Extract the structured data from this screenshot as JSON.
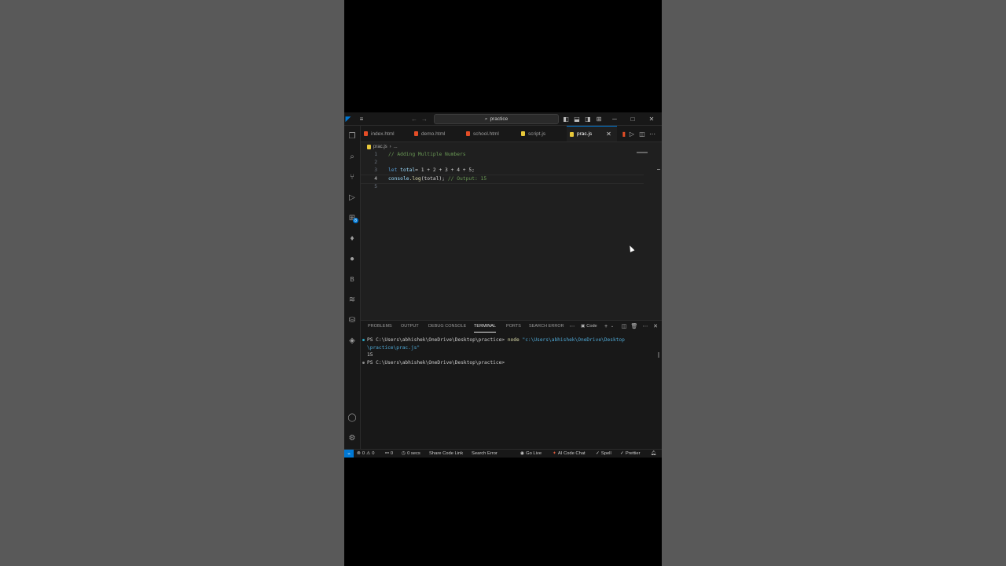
{
  "colors": {
    "accent": "#0078d4",
    "background": "#1f1f1f",
    "html_icon": "#e44d26",
    "js_icon": "#e8c83a"
  },
  "titlebar": {
    "app_icon": "vscode-icon",
    "menu_icon": "hamburger-icon",
    "search_text": "practice"
  },
  "tabs": [
    {
      "label": "index.html",
      "type": "html",
      "active": false
    },
    {
      "label": "demo.html",
      "type": "html",
      "active": false
    },
    {
      "label": "school.html",
      "type": "html",
      "active": false
    },
    {
      "label": "script.js",
      "type": "js",
      "active": false
    },
    {
      "label": "prac.js",
      "type": "js",
      "active": true
    }
  ],
  "breadcrumb": {
    "file": "prac.js",
    "rest": "..."
  },
  "activity_bar": {
    "extensions_badge": "8",
    "bottom_label": "B"
  },
  "editor": {
    "lines": [
      {
        "num": "1",
        "text": "// Adding Multiple Numbers"
      },
      {
        "num": "2",
        "text": ""
      },
      {
        "num": "3",
        "kw": "let",
        "var": "total",
        "expr": " = 1 + 2 + 3 + 4 + 5;"
      },
      {
        "num": "4",
        "obj": "console",
        "fn": ".log",
        "args": "(total);",
        "comment": "// Output: 15"
      },
      {
        "num": "5",
        "text": ""
      }
    ]
  },
  "panel": {
    "tabs": [
      "PROBLEMS",
      "OUTPUT",
      "DEBUG CONSOLE",
      "TERMINAL",
      "PORTS",
      "SEARCH ERROR"
    ],
    "active_tab": "TERMINAL",
    "shell_label": "Code",
    "terminal": {
      "prompt1": "PS C:\\Users\\abhishek\\OneDrive\\Desktop\\practice>",
      "command": "node",
      "arg_part1": "\"c:\\Users\\abhishek\\OneDrive\\Desktop",
      "arg_part2": "\\practice\\prac.js\"",
      "output": "15",
      "prompt2": "PS C:\\Users\\abhishek\\OneDrive\\Desktop\\practice>"
    }
  },
  "statusbar": {
    "problems": "0",
    "warnings": "0",
    "ports": "0",
    "timer": "0 secs",
    "share": "Share Code Link",
    "search_error": "Search Error",
    "go_live": "Go Live",
    "ai_chat": "AI Code Chat",
    "spell": "Spell",
    "prettier": "Prettier"
  }
}
